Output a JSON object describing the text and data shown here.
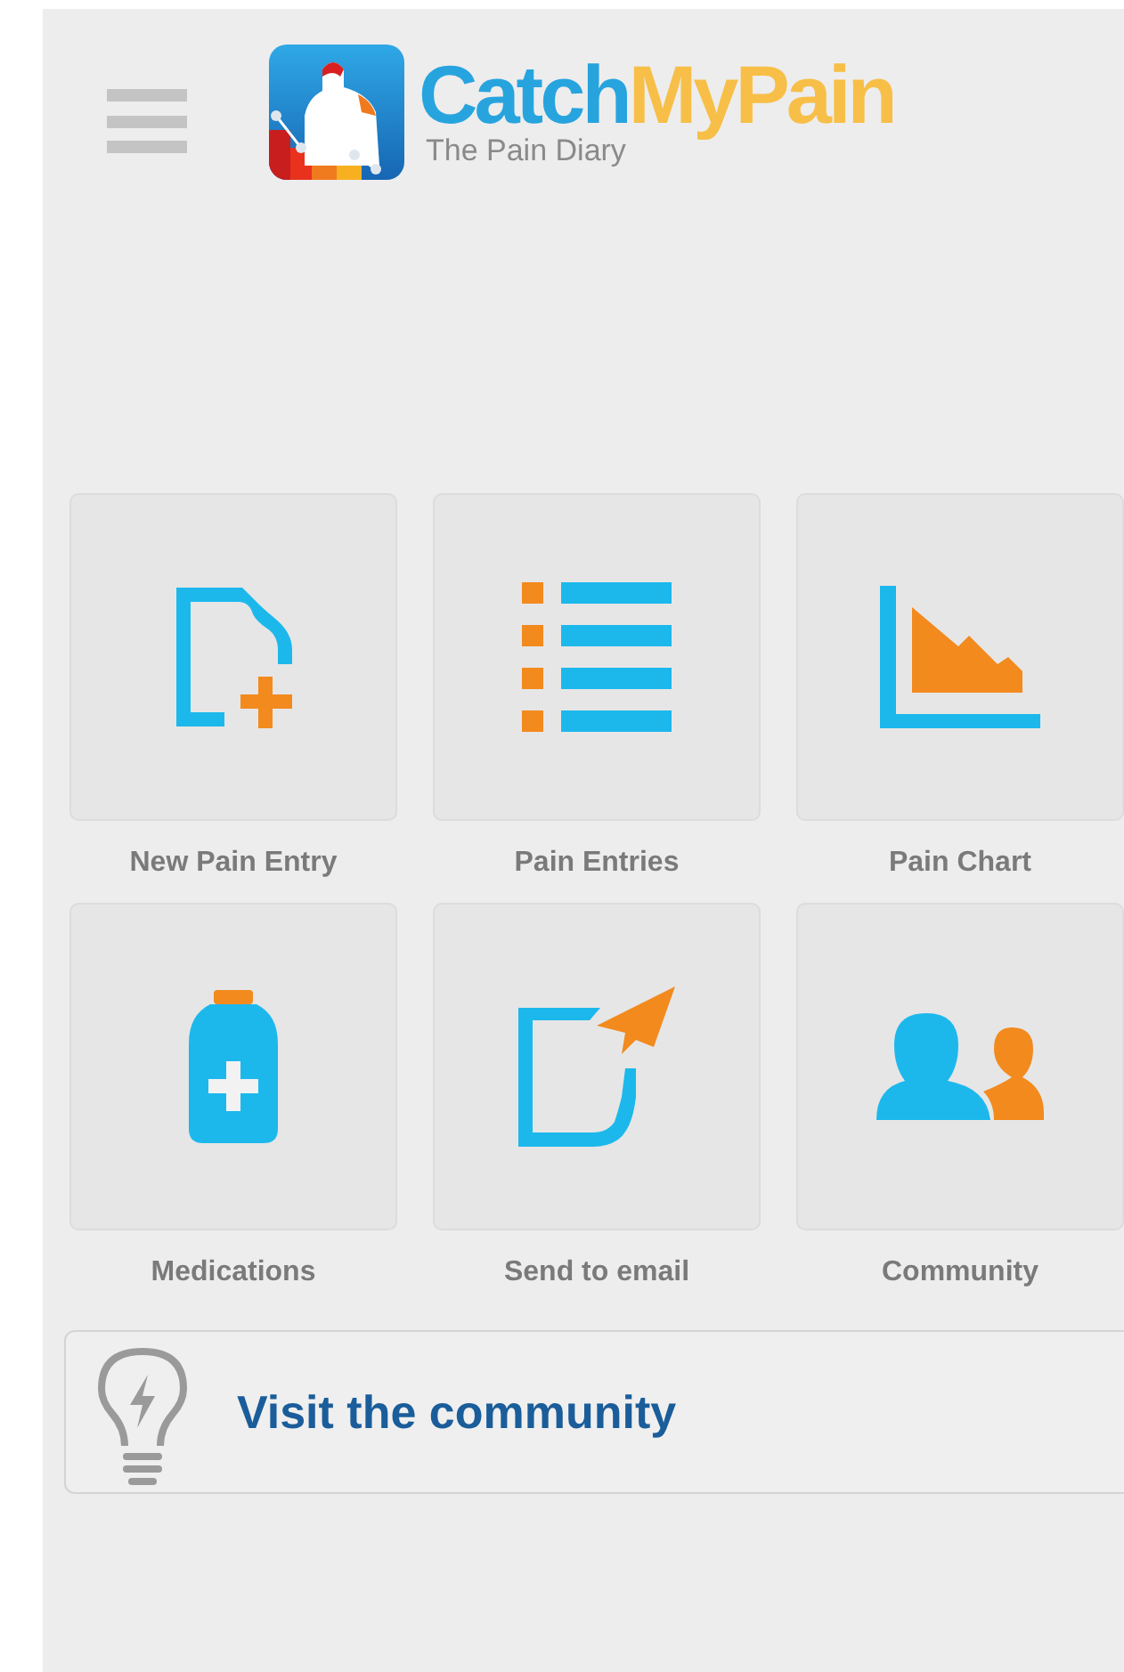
{
  "header": {
    "app_name_parts": [
      "Catch",
      "MyPain"
    ],
    "tagline": "The Pain Diary"
  },
  "tiles": [
    {
      "kind": "new-entry",
      "label": "New Pain Entry"
    },
    {
      "kind": "entries",
      "label": "Pain Entries"
    },
    {
      "kind": "chart",
      "label": "Pain Chart"
    },
    {
      "kind": "medications",
      "label": "Medications"
    },
    {
      "kind": "email",
      "label": "Send to email"
    },
    {
      "kind": "community",
      "label": "Community"
    }
  ],
  "banner": {
    "text": "Visit the community"
  }
}
